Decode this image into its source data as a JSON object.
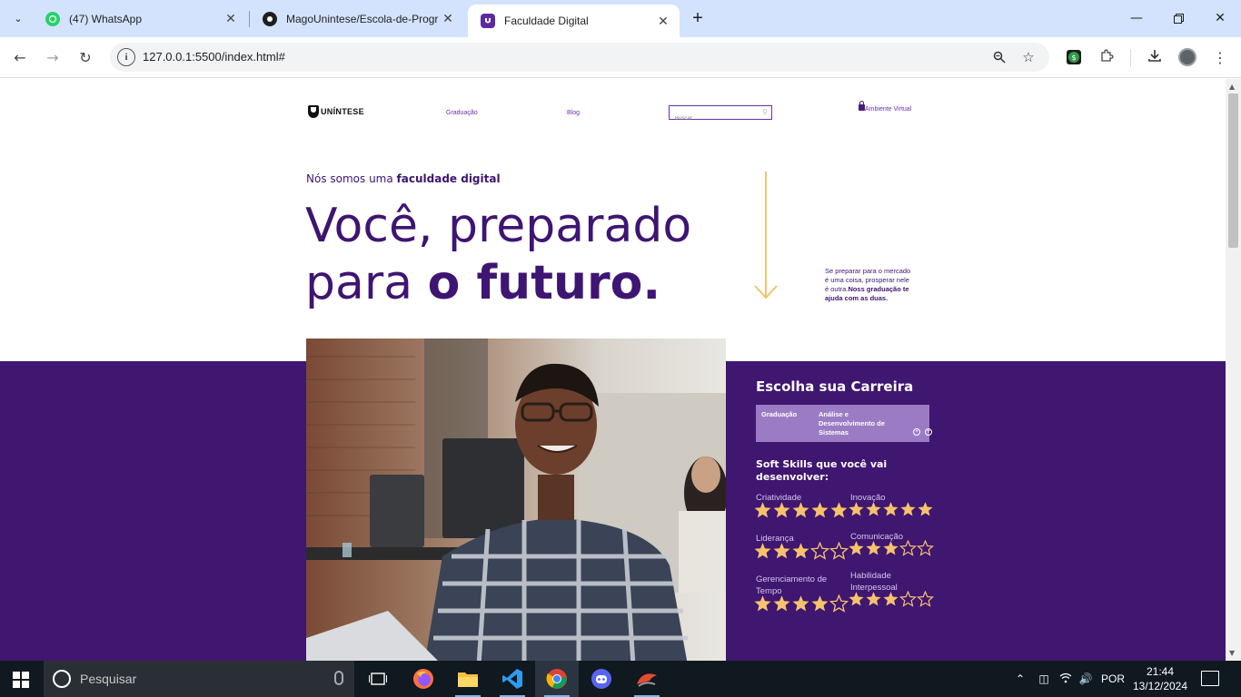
{
  "browser": {
    "tabs": [
      {
        "title": "(47) WhatsApp",
        "icon": "whatsapp-icon"
      },
      {
        "title": "MagoUnintese/Escola-de-Programacao",
        "icon": "github-icon"
      },
      {
        "title": "Faculdade Digital",
        "icon": "unintese-icon",
        "active": true
      }
    ],
    "url": "127.0.0.1:5500/index.html#"
  },
  "site": {
    "logo_text": "UNÍNTESE",
    "nav": {
      "graduacao": "Graduação",
      "blog": "Blog"
    },
    "search_placeholder": "Buscar",
    "virtual_label": "Ambiente Virtual",
    "hero": {
      "eyebrow_prefix": "Nós somos uma ",
      "eyebrow_strong": "faculdade digital",
      "headline_line1": "Você, preparado",
      "headline_line2_prefix": "para ",
      "headline_line2_strong": "o futuro.",
      "tagline_prefix": "Se preparar para o mercado é uma coisa, prosperar nele é outra.",
      "tagline_strong": "Noss graduação te ajuda com as duas."
    },
    "career": {
      "title": "Escolha sua Carreira",
      "level": "Graduação",
      "course": "Análise e Desenvolvimento de Sistemas"
    },
    "skills": {
      "title": "Soft Skills que você vai desenvolver:",
      "items": [
        {
          "name": "Criatividade",
          "rating": 5,
          "max": 5
        },
        {
          "name": "Inovação",
          "rating": 5,
          "max": 5
        },
        {
          "name": "Liderança",
          "rating": 3,
          "max": 5
        },
        {
          "name": "Comunicação",
          "rating": 3,
          "max": 5
        },
        {
          "name": "Gerenciamento de Tempo",
          "rating": 4,
          "max": 5
        },
        {
          "name": "Habilidade Interpessoal",
          "rating": 3,
          "max": 5
        }
      ]
    },
    "colors": {
      "primary": "#3f1670",
      "star": "#f6c26b",
      "accent": "#9b7cc4"
    }
  },
  "taskbar": {
    "search_placeholder": "Pesquisar",
    "language": "POR",
    "time": "21:44",
    "date": "13/12/2024"
  }
}
